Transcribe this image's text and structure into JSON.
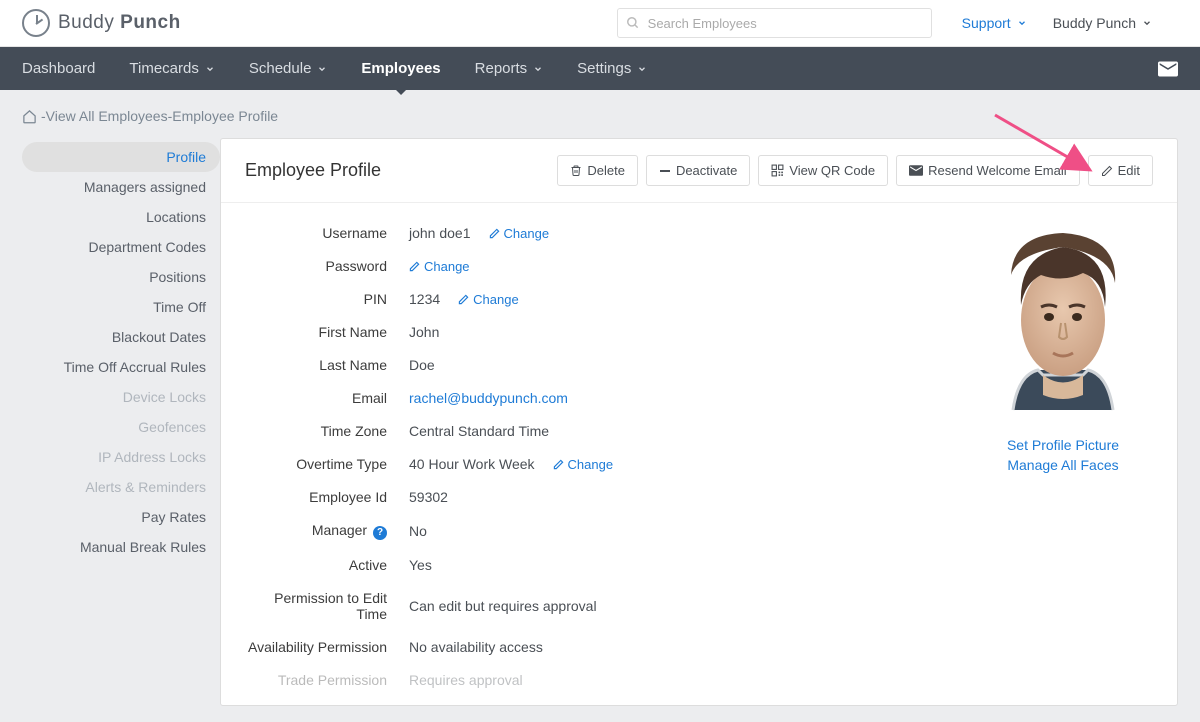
{
  "header": {
    "brand_light": "Buddy",
    "brand_bold": "Punch",
    "search_placeholder": "Search Employees",
    "support": "Support",
    "user_menu": "Buddy Punch"
  },
  "nav": [
    {
      "label": "Dashboard",
      "active": false,
      "dropdown": false
    },
    {
      "label": "Timecards",
      "active": false,
      "dropdown": true
    },
    {
      "label": "Schedule",
      "active": false,
      "dropdown": true
    },
    {
      "label": "Employees",
      "active": true,
      "dropdown": false
    },
    {
      "label": "Reports",
      "active": false,
      "dropdown": true
    },
    {
      "label": "Settings",
      "active": false,
      "dropdown": true
    }
  ],
  "breadcrumb": {
    "sep1": " - ",
    "part1": "View All Employees",
    "sep2": " - ",
    "part2": "Employee Profile"
  },
  "sidebar": [
    {
      "label": "Profile",
      "active": true,
      "muted": false
    },
    {
      "label": "Managers assigned",
      "active": false,
      "muted": false
    },
    {
      "label": "Locations",
      "active": false,
      "muted": false
    },
    {
      "label": "Department Codes",
      "active": false,
      "muted": false
    },
    {
      "label": "Positions",
      "active": false,
      "muted": false
    },
    {
      "label": "Time Off",
      "active": false,
      "muted": false
    },
    {
      "label": "Blackout Dates",
      "active": false,
      "muted": false
    },
    {
      "label": "Time Off Accrual Rules",
      "active": false,
      "muted": false
    },
    {
      "label": "Device Locks",
      "active": false,
      "muted": true
    },
    {
      "label": "Geofences",
      "active": false,
      "muted": true
    },
    {
      "label": "IP Address Locks",
      "active": false,
      "muted": true
    },
    {
      "label": "Alerts & Reminders",
      "active": false,
      "muted": true
    },
    {
      "label": "Pay Rates",
      "active": false,
      "muted": false
    },
    {
      "label": "Manual Break Rules",
      "active": false,
      "muted": false
    }
  ],
  "main": {
    "title": "Employee Profile",
    "actions": {
      "delete": "Delete",
      "deactivate": "Deactivate",
      "view_qr": "View QR Code",
      "resend": "Resend Welcome Email",
      "edit": "Edit"
    },
    "change": "Change",
    "fields": {
      "username": {
        "label": "Username",
        "value": "john doe1",
        "change": true
      },
      "password": {
        "label": "Password",
        "value": "",
        "change": true
      },
      "pin": {
        "label": "PIN",
        "value": "1234",
        "change": true
      },
      "first_name": {
        "label": "First Name",
        "value": "John"
      },
      "last_name": {
        "label": "Last Name",
        "value": "Doe"
      },
      "email": {
        "label": "Email",
        "value": "rachel@buddypunch.com",
        "link": true
      },
      "time_zone": {
        "label": "Time Zone",
        "value": "Central Standard Time"
      },
      "overtime": {
        "label": "Overtime Type",
        "value": "40 Hour Work Week",
        "change": true
      },
      "employee_id": {
        "label": "Employee Id",
        "value": "59302"
      },
      "manager": {
        "label": "Manager",
        "value": "No",
        "help": true
      },
      "active": {
        "label": "Active",
        "value": "Yes"
      },
      "permission_edit": {
        "label": "Permission to Edit Time",
        "value": "Can edit but requires approval"
      },
      "availability": {
        "label": "Availability Permission",
        "value": "No availability access"
      },
      "trade": {
        "label": "Trade Permission",
        "value": "Requires approval"
      }
    },
    "photo": {
      "set_picture": "Set Profile Picture",
      "manage_faces": "Manage All Faces"
    }
  }
}
